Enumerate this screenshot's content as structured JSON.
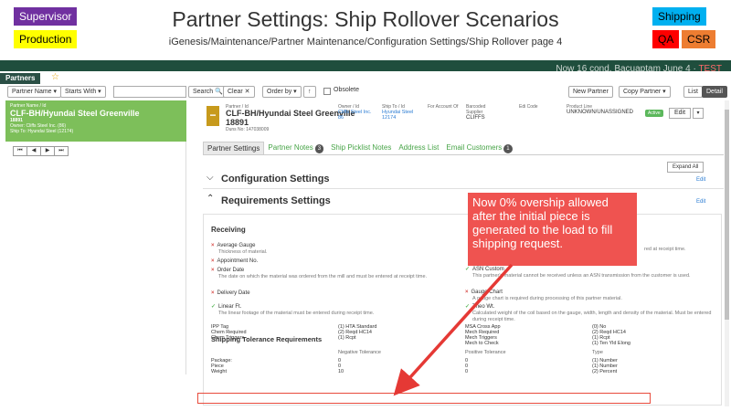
{
  "slide": {
    "title": "Partner Settings: Ship Rollover Scenarios",
    "subtitle": "iGenesis/Maintenance/Partner Maintenance/Configuration Settings/Ship Rollover page 4",
    "tags": {
      "supervisor": "Supervisor",
      "production": "Production",
      "shipping": "Shipping",
      "qa": "QA",
      "csr": "CSR"
    },
    "callout": "Now 0% overship allowed after the initial piece is generated to the load to fill shipping request."
  },
  "app": {
    "user_info": "TEST",
    "user_prefix": "Now 16 cond. Bacuaptam  June 4 ·",
    "section_tab": "Partners",
    "toolbar": {
      "partner_name": "Partner Name ▾",
      "starts_with": "Starts With ▾",
      "search": "Search 🔍",
      "clear": "Clear ✕",
      "order_by": "Order by ▾",
      "up": "↑",
      "obsolete": "Obsolete",
      "new_partner": "New Partner",
      "copy_partner": "Copy Partner ▾",
      "list": "List",
      "detail": "Detail"
    }
  },
  "left": {
    "label": "Partner Name / Id",
    "name": "CLF-BH/Hyundai Steel Greenville",
    "id": "18891",
    "owner": "Owner: Cliffs Steel Inc. (86)",
    "ship_to": "Ship To: Hyundai Steel (12174)",
    "pager": [
      "⏮",
      "◀",
      "▶",
      "⏭"
    ]
  },
  "partner": {
    "label_partner": "Partner / Id",
    "name": "CLF-BH/Hyundai Steel Greenville",
    "id": "18891",
    "duns": "Duns No: 147038009",
    "label_owner": "Owner / Id",
    "owner": "Cliffs Steel Inc.",
    "owner_id": "86",
    "label_ship_to": "Ship To / Id",
    "ship_to": "Hyundai Steel",
    "ship_to_id": "12174",
    "label_account": "For Account Of",
    "label_barcoded": "Barcoded Supplier",
    "barcoded": "CLIFFS",
    "label_edi": "Edi Code",
    "label_product": "Product Line",
    "product": "UNKNOWN/UNASSIGNED",
    "status": "Active",
    "edit": "Edit",
    "edit_caret": "▾"
  },
  "tabs": [
    {
      "label": "Partner Settings",
      "count": ""
    },
    {
      "label": "Partner Notes",
      "count": "3"
    },
    {
      "label": "Ship Picklist Notes",
      "count": ""
    },
    {
      "label": "Address List",
      "count": ""
    },
    {
      "label": "Email Customers",
      "count": "1"
    }
  ],
  "expand_all": "Expand All",
  "config_section": {
    "title": "Configuration Settings",
    "edit": "Edit"
  },
  "req_section": {
    "title": "Requirements Settings",
    "edit": "Edit"
  },
  "receiving": {
    "title": "Receiving",
    "left_items": [
      {
        "mark": "×",
        "ok": false,
        "label": "Average Gauge",
        "desc": "Thickness of material."
      },
      {
        "mark": "×",
        "ok": false,
        "label": "Appointment No.",
        "desc": ""
      },
      {
        "mark": "×",
        "ok": false,
        "label": "Order Date",
        "desc": "The date on which the material was ordered from the mill and must be entered at receipt time."
      },
      {
        "mark": "×",
        "ok": false,
        "label": "Delivery Date",
        "desc": ""
      },
      {
        "mark": "✓",
        "ok": true,
        "label": "Linear Ft.",
        "desc": "The linear footage of the material must be entered during receipt time."
      }
    ],
    "right_items": [
      {
        "mark": "",
        "ok": true,
        "label": "",
        "desc": "red at receipt time."
      },
      {
        "mark": "✓",
        "ok": true,
        "label": "ASN Custom",
        "desc": "This partner's material cannot be received unless an ASN transmission from the customer is used."
      },
      {
        "mark": "×",
        "ok": false,
        "label": "Gauge Chart",
        "desc": "A gauge chart is required during processing of this partner material."
      },
      {
        "mark": "✓",
        "ok": true,
        "label": "Theo Wt.",
        "desc": "Calculated weight of the coil based on the gauge, width, length and density of the material. Must be entered during receipt time."
      }
    ],
    "kv_left_keys": [
      "IPP Tag",
      "Chem Required",
      "Chem Triggers"
    ],
    "kv_left_vals": [
      "(1) HTA Standard",
      "(2) Reqd HC14",
      "(1) Rcpt"
    ],
    "kv_right_keys": [
      "MSA Cross App",
      "Mech Required",
      "Mech Triggers",
      "Mech to Check"
    ],
    "kv_right_vals": [
      "(0) No",
      "(2) Reqd HC14",
      "(1) Rcpt",
      "(1) Ten Yld Elong"
    ]
  },
  "shipping_tolerance": {
    "title": "Shipping Tolerance Requirements",
    "headers": [
      "Negative Tolerance",
      "Positive Tolerance",
      "Type"
    ],
    "rows": [
      {
        "name": "Package:",
        "neg": "0",
        "pos": "0",
        "type": "(1) Number"
      },
      {
        "name": "Piece",
        "neg": "0",
        "pos": "0",
        "type": "(1) Number"
      },
      {
        "name": "Weight",
        "neg": "10",
        "pos": "0",
        "type": "(2) Percent"
      }
    ]
  },
  "colors": {
    "callout": "#ef5350",
    "accent_green": "#7dbf5a",
    "highlight": "#e84b3c"
  }
}
